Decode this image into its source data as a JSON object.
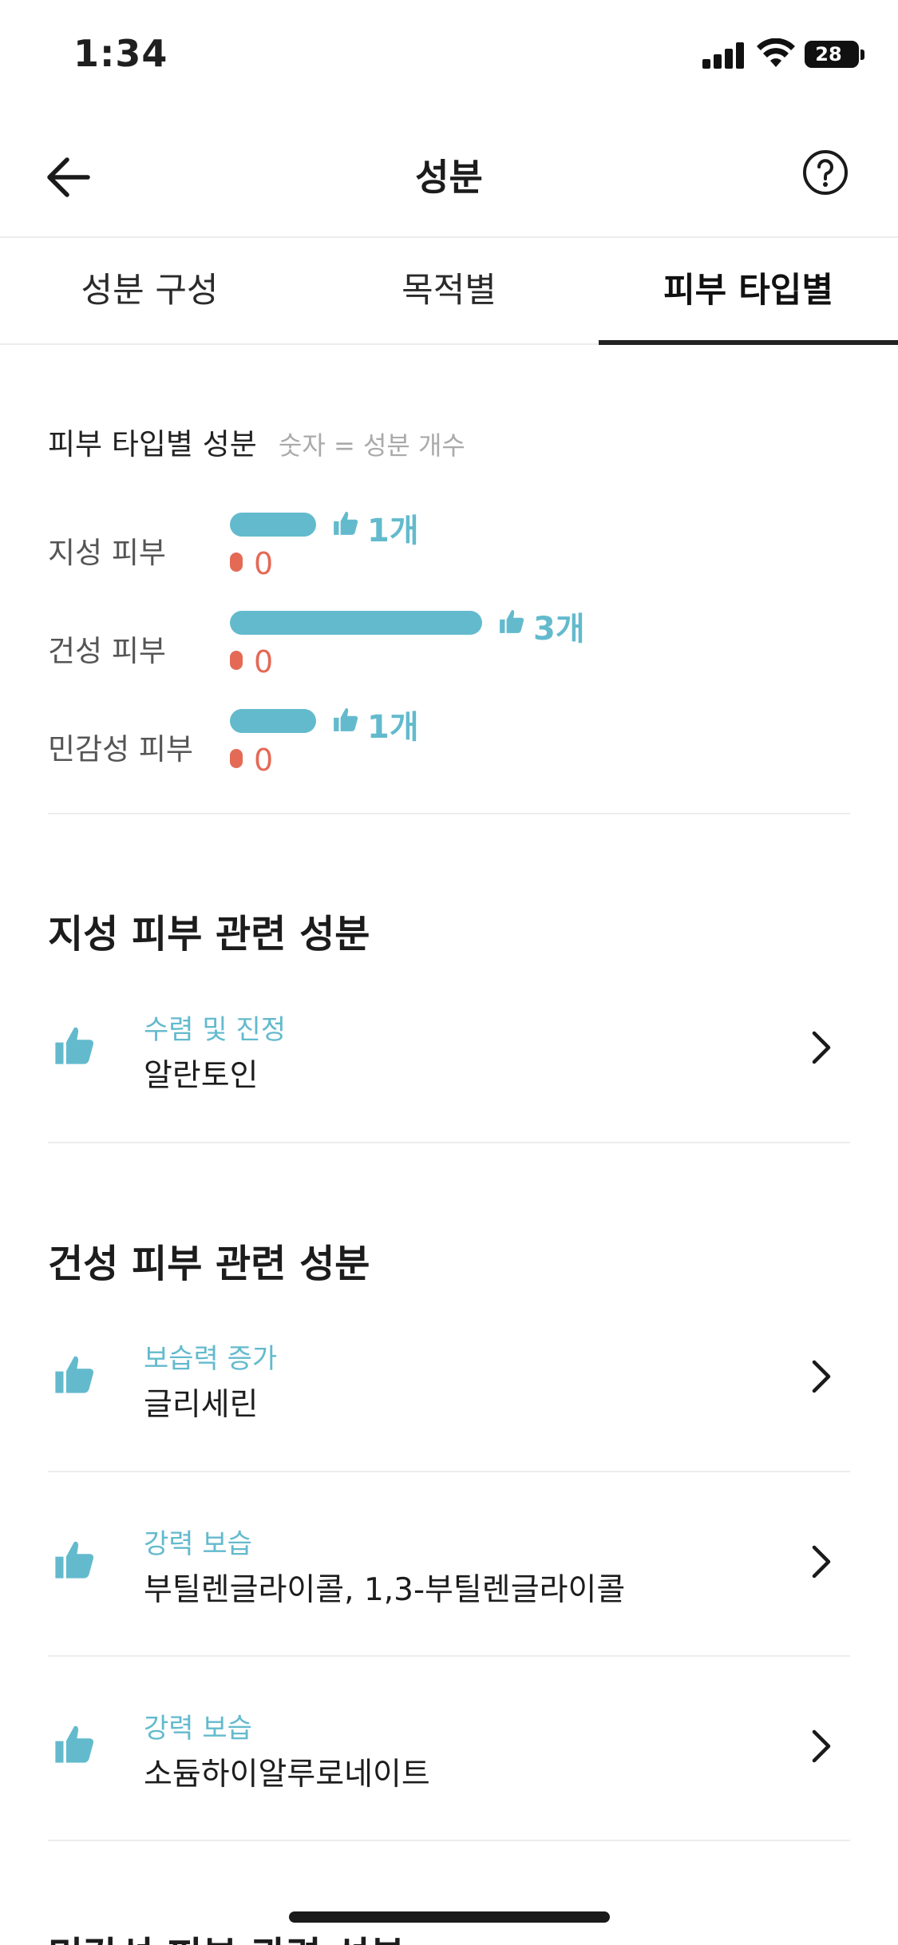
{
  "status": {
    "time": "1:34",
    "battery": "28"
  },
  "nav": {
    "title": "성분",
    "back_icon": "arrow-left-icon",
    "help_icon": "question-circle-icon"
  },
  "tabs": [
    {
      "label": "성분 구성",
      "active": false
    },
    {
      "label": "목적별",
      "active": false
    },
    {
      "label": "피부 타입별",
      "active": true
    }
  ],
  "summary": {
    "title": "피부 타입별 성분",
    "hint": "숫자 = 성분 개수",
    "rows": [
      {
        "label": "지성 피부",
        "positive": 1,
        "positive_text": "1개",
        "negative_text": "0"
      },
      {
        "label": "건성 피부",
        "positive": 3,
        "positive_text": "3개",
        "negative_text": "0"
      },
      {
        "label": "민감성 피부",
        "positive": 1,
        "positive_text": "1개",
        "negative_text": "0"
      }
    ]
  },
  "sections": [
    {
      "title": "지성 피부 관련 성분",
      "items": [
        {
          "purpose": "수렴 및 진정",
          "name": "알란토인"
        }
      ]
    },
    {
      "title": "건성 피부 관련 성분",
      "items": [
        {
          "purpose": "보습력 증가",
          "name": "글리세린"
        },
        {
          "purpose": "강력 보습",
          "name": "부틸렌글라이콜, 1,3-부틸렌글라이콜"
        },
        {
          "purpose": "강력 보습",
          "name": "소듐하이알루로네이트"
        }
      ]
    },
    {
      "title": "민감성 피부 관련 성분",
      "items": []
    }
  ],
  "colors": {
    "accent": "#63bacd",
    "negative": "#e46a56",
    "text": "#1f1f1f"
  }
}
